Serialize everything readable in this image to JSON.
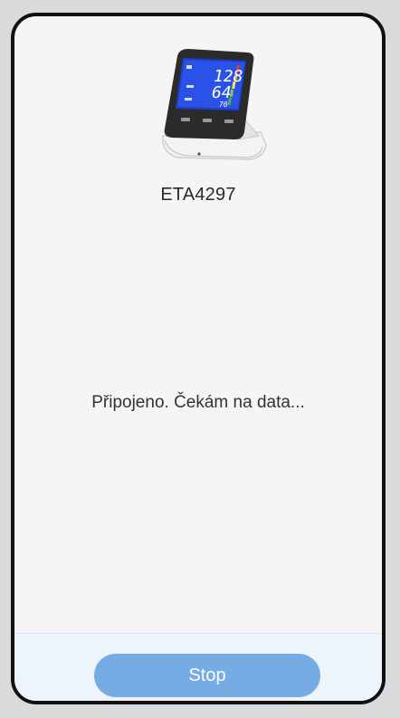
{
  "device": {
    "name": "ETA4297",
    "image_icon": "blood-pressure-monitor-icon",
    "screen": {
      "systolic": "128",
      "diastolic": "64",
      "pulse": "70"
    }
  },
  "status": {
    "message": "Připojeno. Čekám na data..."
  },
  "actions": {
    "stop_label": "Stop"
  },
  "colors": {
    "accent": "#74ace3",
    "background": "#f5f5f5",
    "bottom_bar": "#eef4fb"
  }
}
